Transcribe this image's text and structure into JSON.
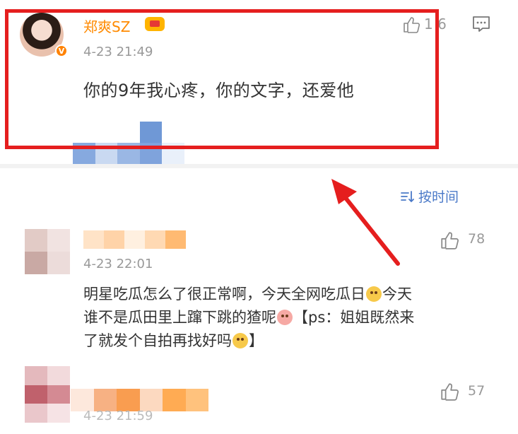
{
  "top_comment": {
    "username": "郑爽SZ",
    "badge_label": "V",
    "time": "4-23 21:49",
    "text": "你的9年我心疼，你的文字，还爱他",
    "like_count": "1 6"
  },
  "sort": {
    "label": "按时间"
  },
  "comment2": {
    "time": "4-23 22:01",
    "like_count": "78",
    "text_line1a": "明星吃瓜怎么了很正常啊，今天全网吃瓜日",
    "text_line1b": "今天",
    "text_line2a": "谁不是瓜田里上蹿下跳的猹呢",
    "text_line2b": "【ps：姐姐既然来",
    "text_line3a": "了就发个自拍再找好吗",
    "text_line3b": "】"
  },
  "comment3": {
    "time": "4-23 21:59",
    "like_count": "57"
  },
  "colors": {
    "highlight": "#e51e1e",
    "username": "#ff8a00",
    "link": "#4a79c8",
    "muted": "#999999"
  },
  "icons": [
    "like-icon",
    "comment-icon",
    "sort-icon",
    "crown-icon",
    "verified-badge-icon",
    "arrow-icon"
  ]
}
